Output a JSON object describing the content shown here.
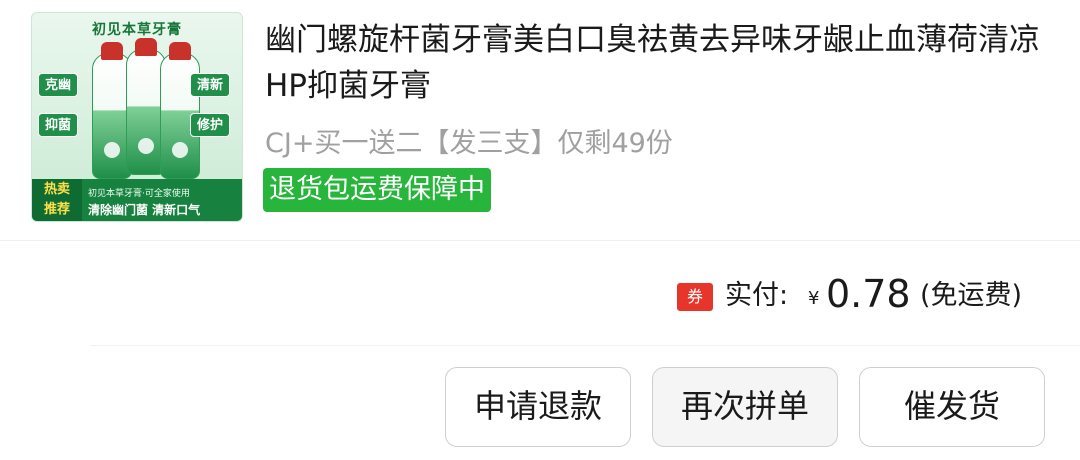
{
  "product": {
    "image": {
      "top_text": "初见本草牙膏",
      "tags": [
        "克幽",
        "抑菌",
        "清新",
        "修护"
      ],
      "hot_label_line1": "热卖",
      "hot_label_line2": "推荐",
      "bottom_line1": "初见本草牙膏·可全家使用",
      "bottom_line2": "清除幽门菌 清新口气",
      "accent_color": "#1f8f49"
    },
    "title": "幽门螺旋杆菌牙膏美白口臭祛黄去异味牙龈止血薄荷清凉HP抑菌牙膏",
    "variant": "CJ+买一送二【发三支】仅剩49份",
    "guarantee_badge": "退货包运费保障中",
    "guarantee_color": "#28b53c"
  },
  "price": {
    "coupon_badge": "券",
    "coupon_color": "#e8352b",
    "paid_label": "实付:",
    "currency": "¥",
    "amount": "0.78",
    "shipping_note": "(免运费)"
  },
  "actions": {
    "refund": "申请退款",
    "buy_again": "再次拼单",
    "urge_shipping": "催发货"
  }
}
